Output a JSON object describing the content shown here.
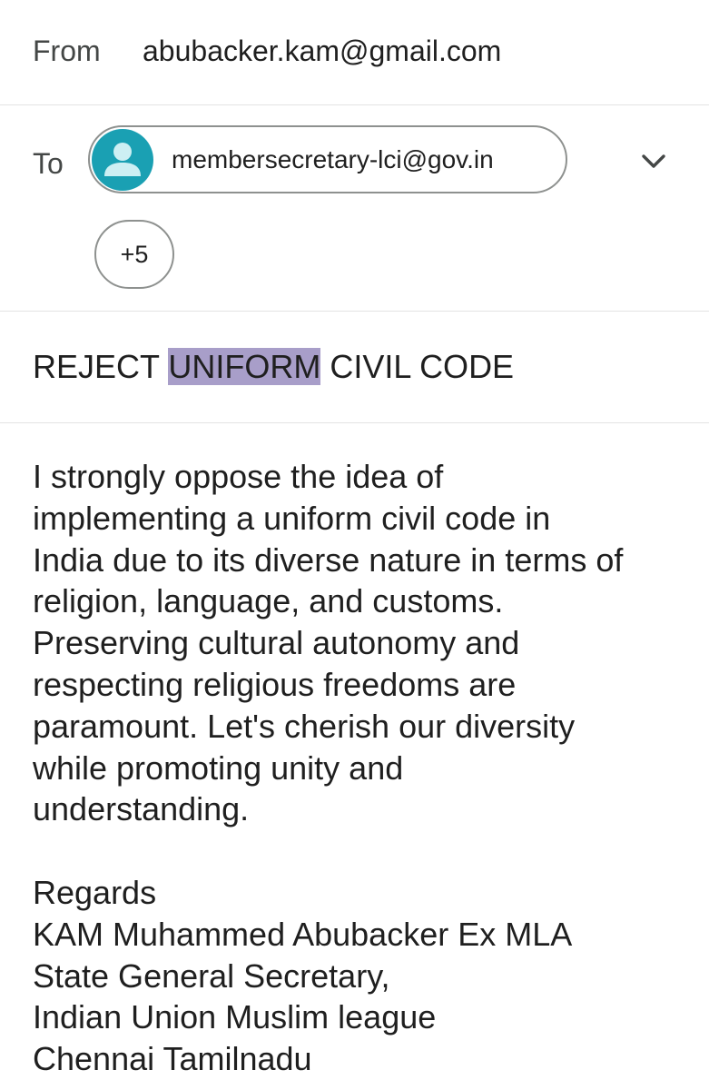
{
  "from": {
    "label": "From",
    "value": "abubacker.kam@gmail.com"
  },
  "to": {
    "label": "To",
    "recipient": "membersecretary-lci@gov.in",
    "more_count": "+5",
    "expand_icon": "chevron-down-icon"
  },
  "subject": {
    "before": "REJECT ",
    "highlighted": "UNIFORM",
    "after": " CIVIL CODE"
  },
  "body": {
    "text": "I strongly oppose the idea of\nimplementing a uniform civil code in\nIndia due to its diverse nature in terms of\nreligion, language, and customs.\nPreserving cultural autonomy and\nrespecting religious freedoms are\nparamount. Let's cherish our diversity\nwhile promoting unity and\nunderstanding.\n\nRegards\nKAM Muhammed Abubacker Ex MLA\nState General Secretary,\nIndian Union Muslim league\nChennai Tamilnadu"
  },
  "colors": {
    "avatar": "#1aa0b3",
    "highlight": "#a89ec9",
    "chip_border": "#8e918f",
    "divider": "#e3e3e3"
  }
}
